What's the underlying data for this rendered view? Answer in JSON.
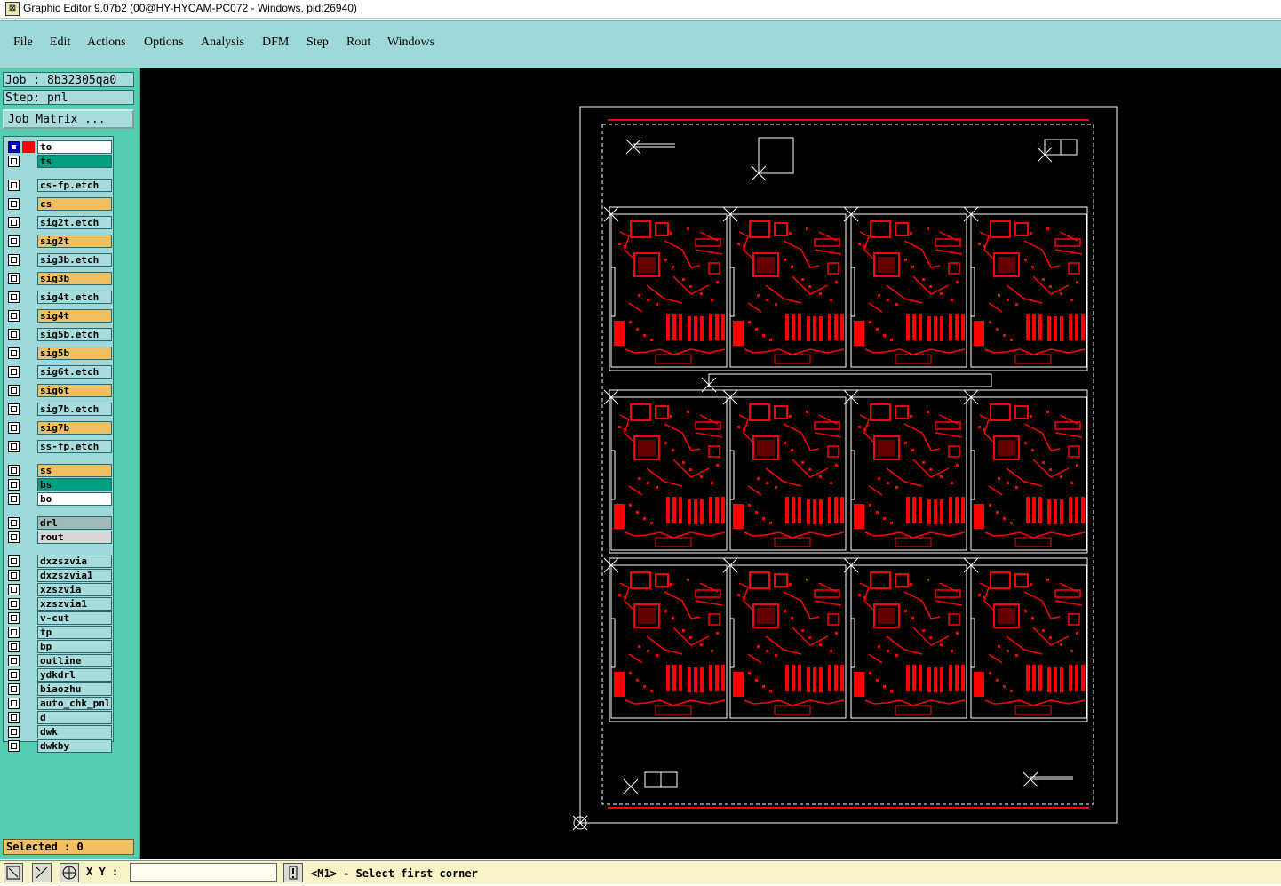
{
  "window": {
    "title": "Graphic Editor 9.07b2 (00@HY-HYCAM-PC072 - Windows, pid:26940)"
  },
  "menu": [
    "File",
    "Edit",
    "Actions",
    "Options",
    "Analysis",
    "DFM",
    "Step",
    "Rout",
    "Windows"
  ],
  "job": {
    "label": "Job : 8b32305qa0",
    "step": "Step: pnl",
    "matrix_button": "Job Matrix ..."
  },
  "layers": [
    {
      "name": "to",
      "color": "#ffffff",
      "active": true
    },
    {
      "name": "ts",
      "color": "#00a080"
    },
    {
      "name": "cs-fp.etch",
      "color": "#a8dcdc"
    },
    {
      "name": "cs",
      "color": "#f0c060"
    },
    {
      "name": "sig2t.etch",
      "color": "#a8dcdc"
    },
    {
      "name": "sig2t",
      "color": "#f0c060"
    },
    {
      "name": "sig3b.etch",
      "color": "#a8dcdc"
    },
    {
      "name": "sig3b",
      "color": "#f0c060"
    },
    {
      "name": "sig4t.etch",
      "color": "#a8dcdc"
    },
    {
      "name": "sig4t",
      "color": "#f0c060"
    },
    {
      "name": "sig5b.etch",
      "color": "#a8dcdc"
    },
    {
      "name": "sig5b",
      "color": "#f0c060"
    },
    {
      "name": "sig6t.etch",
      "color": "#a8dcdc"
    },
    {
      "name": "sig6t",
      "color": "#f0c060"
    },
    {
      "name": "sig7b.etch",
      "color": "#a8dcdc"
    },
    {
      "name": "sig7b",
      "color": "#f0c060"
    },
    {
      "name": "ss-fp.etch",
      "color": "#a8dcdc"
    },
    {
      "name": "ss",
      "color": "#f0c060"
    },
    {
      "name": "bs",
      "color": "#00a080"
    },
    {
      "name": "bo",
      "color": "#ffffff"
    },
    {
      "name": "drl",
      "color": "#a0b8b8"
    },
    {
      "name": "rout",
      "color": "#d8d8d8"
    },
    {
      "name": "dxzszvia",
      "color": "#a8dcdc"
    },
    {
      "name": "dxzszvia1",
      "color": "#a8dcdc"
    },
    {
      "name": "xzszvia",
      "color": "#a8dcdc"
    },
    {
      "name": "xzszvia1",
      "color": "#a8dcdc"
    },
    {
      "name": "v-cut",
      "color": "#a8dcdc"
    },
    {
      "name": "tp",
      "color": "#a8dcdc"
    },
    {
      "name": "bp",
      "color": "#a8dcdc"
    },
    {
      "name": "outline",
      "color": "#a8dcdc"
    },
    {
      "name": "ydkdrl",
      "color": "#a8dcdc"
    },
    {
      "name": "biaozhu",
      "color": "#a8dcdc"
    },
    {
      "name": "auto_chk_pnl",
      "color": "#a8dcdc"
    },
    {
      "name": "d",
      "color": "#a8dcdc"
    },
    {
      "name": "dwk",
      "color": "#a8dcdc"
    },
    {
      "name": "dwkby",
      "color": "#a8dcdc"
    }
  ],
  "status": {
    "selected": "Selected : 0",
    "xy_label": "X Y :",
    "xy_value": "",
    "prompt": "<M1> - Select first corner"
  },
  "colors": {
    "menubar": "#9fd8d8",
    "panel": "#52cfb0",
    "board_copper": "#ff0000",
    "outline": "#ffffff"
  },
  "icons": [
    "zoom-window-icon",
    "measure-icon",
    "grid-snap-icon",
    "alert-icon"
  ]
}
